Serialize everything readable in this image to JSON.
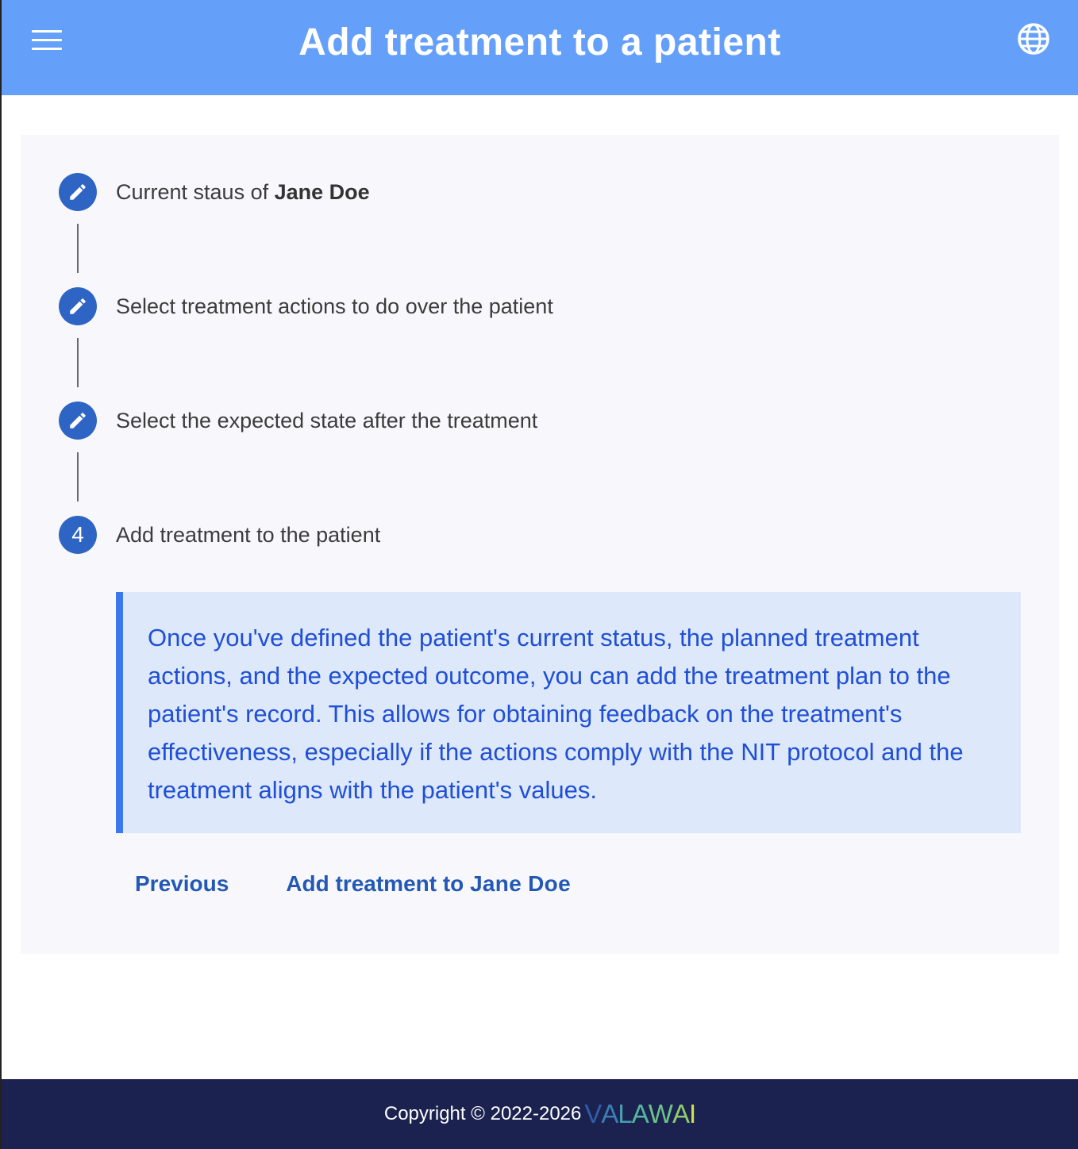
{
  "header": {
    "title": "Add treatment to a patient",
    "menu_icon": "hamburger-menu-icon",
    "language_icon": "globe-icon",
    "background": "#64a0fa"
  },
  "stepper": {
    "steps": [
      {
        "label_prefix": "Current staus of ",
        "label_bold": "Jane Doe",
        "icon": "pencil-icon",
        "state": "completed"
      },
      {
        "label": "Select treatment actions to do over the patient",
        "icon": "pencil-icon",
        "state": "completed"
      },
      {
        "label": "Select the expected state after the treatment",
        "icon": "pencil-icon",
        "state": "completed"
      },
      {
        "number": "4",
        "label": "Add treatment to the patient",
        "state": "active"
      }
    ],
    "accent": "#2e64c4"
  },
  "info": {
    "text": "Once you've defined the patient's current status, the planned treatment actions, and the expected outcome, you can add the treatment plan to the patient's record. This allows for obtaining feedback on the treatment's effectiveness, especially if the actions comply with the NIT protocol and the treatment aligns with the patient's values.",
    "background": "#dde8fa",
    "border_color": "#3c78ee",
    "text_color": "#1f4fd6"
  },
  "actions": {
    "previous_label": "Previous",
    "add_prefix": "Add treatment to ",
    "add_patient": "Jane Doe"
  },
  "footer": {
    "copyright": "Copyright © 2022-2026",
    "brand": "VALAWAI",
    "brand_colors": [
      "#2f5fa8",
      "#3b7fb5",
      "#4aa0b2",
      "#55b6a0",
      "#6cc28a",
      "#8dcb6e",
      "#d6e04a"
    ],
    "background": "#1b2250"
  }
}
